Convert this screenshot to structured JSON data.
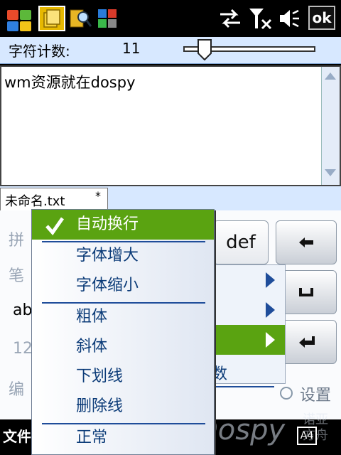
{
  "status_bar": {
    "icons": [
      "windows-start-icon",
      "notes-app-icon",
      "search-app-icon",
      "tiles-app-icon",
      "sync-icon",
      "no-signal-icon",
      "speaker-icon"
    ],
    "ok_label": "ok"
  },
  "counter": {
    "label": "字符计数:",
    "value": "11",
    "slider_fraction": 0.12
  },
  "editor": {
    "text": "wm资源就在dospy"
  },
  "tab": {
    "filename": "未命名.txt",
    "modified_mark": "*"
  },
  "keyboard": {
    "left_labels": [
      "拼",
      "笔",
      "ab",
      "12",
      "编"
    ],
    "key_def": "def",
    "keys": [
      "←",
      "␣",
      "↵"
    ],
    "submenu_partial": "数",
    "settings_label": "设置"
  },
  "menu": {
    "items": [
      {
        "label": "自动换行",
        "checked": true
      },
      {
        "label": "字体增大",
        "checked": false
      },
      {
        "label": "字体缩小",
        "checked": false
      },
      {
        "label": "粗体",
        "checked": false
      },
      {
        "label": "斜体",
        "checked": false
      },
      {
        "label": "下划线",
        "checked": false
      },
      {
        "label": "删除线",
        "checked": false
      },
      {
        "label": "正常",
        "checked": false
      }
    ]
  },
  "bottom_bar": {
    "file_label": "文件",
    "watermark": "Dospy",
    "watermark_small": "诺亚方舟",
    "input_indicator": "A4"
  },
  "colors": {
    "accent_green": "#5aa311",
    "menu_text_blue": "#0b3b78",
    "toolbar_blue": "#d7e8ff"
  }
}
